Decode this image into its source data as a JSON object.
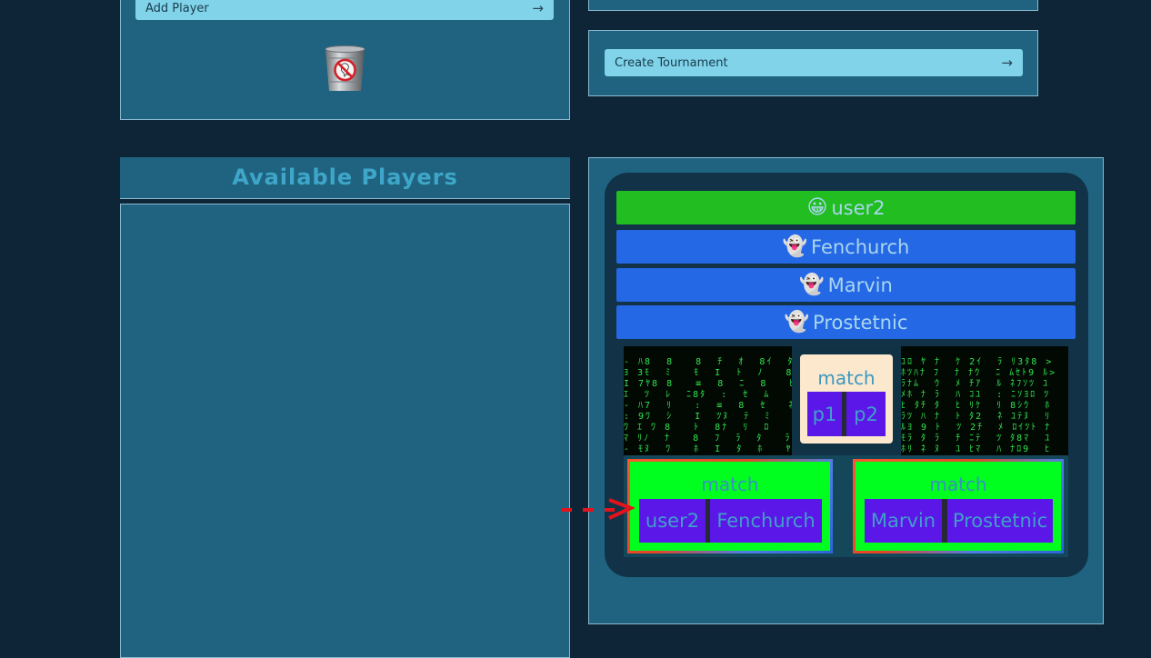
{
  "add_player_panel": {
    "add_player_label": "Add Player",
    "arrow": "→"
  },
  "tournament_panel": {
    "create_tournament_label": "Create Tournament",
    "arrow": "→"
  },
  "available_players": {
    "heading": "Available Players"
  },
  "bracket": {
    "players": [
      {
        "name": "user2",
        "emoji": "😀",
        "color": "#22be21"
      },
      {
        "name": "Fenchurch",
        "emoji": "👻",
        "color": "#2568e6"
      },
      {
        "name": "Marvin",
        "emoji": "👻",
        "color": "#2568e6"
      },
      {
        "name": "Prostetnic",
        "emoji": "👻",
        "color": "#2568e6"
      }
    ],
    "final_match": {
      "title": "match",
      "p1": "p1",
      "p2": "p2"
    },
    "semifinal_left": {
      "title": "match",
      "p1": "user2",
      "p2": "Fenchurch"
    },
    "semifinal_right": {
      "title": "match",
      "p1": "Marvin",
      "p2": "Prostetnic"
    }
  },
  "colors": {
    "background": "#0e2538",
    "panel": "#1f6380",
    "button": "#81d3ea",
    "slot": "#5a17e8",
    "match_green": "#00ff1e",
    "indicator_red": "#e3121b"
  }
}
